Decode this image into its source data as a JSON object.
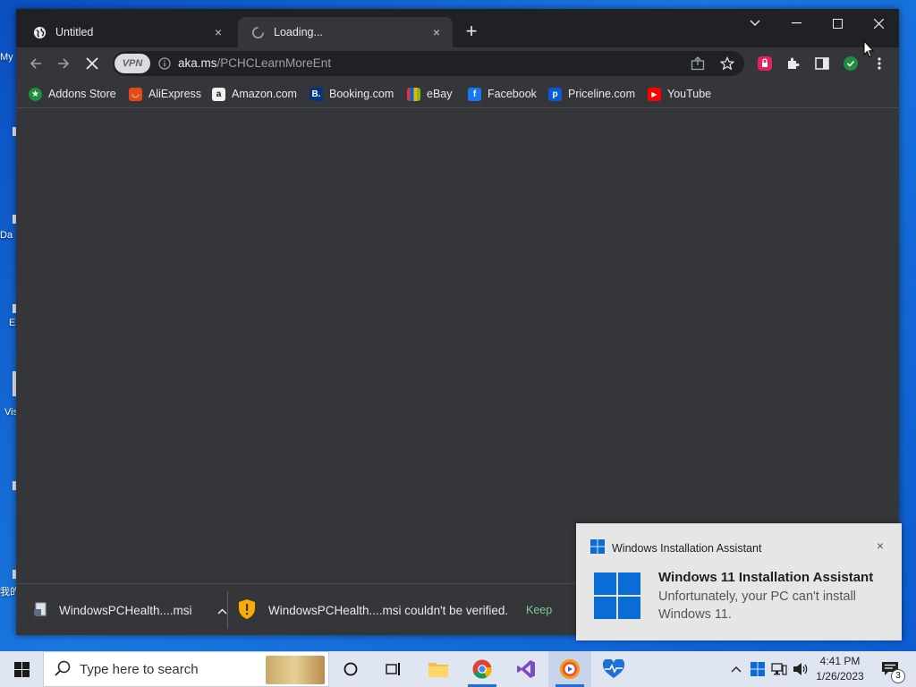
{
  "browser": {
    "tabs": [
      {
        "title": "Untitled",
        "close": "×"
      },
      {
        "title": "Loading...",
        "close": "×"
      }
    ],
    "new_tab": "+",
    "omnibox": {
      "vpn_label": "VPN",
      "url_host": "aka.ms",
      "url_path": "/PCHCLearnMoreEnt"
    },
    "bookmarks": [
      {
        "label": "Addons Store",
        "icon": "addons-icon",
        "color": "#1e8e3e"
      },
      {
        "label": "AliExpress",
        "icon": "aliexpress-icon",
        "color": "#e64a19"
      },
      {
        "label": "Amazon.com",
        "icon": "amazon-icon",
        "color": "#f1f1f1"
      },
      {
        "label": "Booking.com",
        "icon": "booking-icon",
        "color": "#003580"
      },
      {
        "label": "eBay",
        "icon": "ebay-icon",
        "color": "#3a3a3a"
      },
      {
        "label": "Facebook",
        "icon": "facebook-icon",
        "color": "#1877f2"
      },
      {
        "label": "Priceline.com",
        "icon": "priceline-icon",
        "color": "#0a5ad8"
      },
      {
        "label": "YouTube",
        "icon": "youtube-icon",
        "color": "#ff0000"
      }
    ],
    "downloads": {
      "item1_name": "WindowsPCHealth....msi",
      "item2_text": "WindowsPCHealth....msi couldn't be verified.",
      "keep_label": "Keep"
    }
  },
  "desktop": {
    "labels": [
      "My",
      "Da",
      "E",
      "Vis",
      "我的"
    ]
  },
  "toast": {
    "app_name": "Windows Installation Assistant",
    "title": "Windows 11 Installation Assistant",
    "body": "Unfortunately, your PC can't install Windows 11.",
    "close": "×"
  },
  "taskbar": {
    "search_placeholder": "Type here to search",
    "clock_time": "4:41 PM",
    "clock_date": "1/26/2023",
    "notification_count": "3"
  },
  "colors": {
    "accent": "#1e6fd6",
    "chrome_dark": "#202124",
    "chrome_mid": "#35363a",
    "download_warning": "#f9ab00",
    "keep_green": "#81c995"
  }
}
